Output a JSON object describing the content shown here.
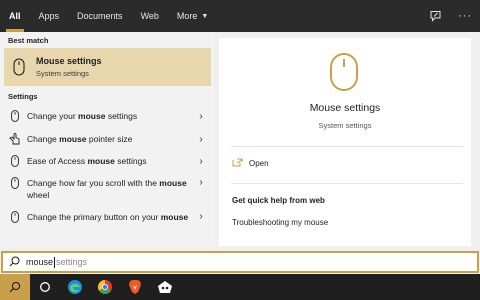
{
  "tabs": [
    {
      "label": "All"
    },
    {
      "label": "Apps"
    },
    {
      "label": "Documents"
    },
    {
      "label": "Web"
    },
    {
      "label": "More"
    }
  ],
  "best_match": {
    "section_label": "Best match",
    "title": "Mouse settings",
    "subtitle": "System settings"
  },
  "settings": {
    "section_label": "Settings",
    "items": [
      {
        "pre": "Change your ",
        "bold": "mouse",
        "post": " settings",
        "icon": "mouse-icon"
      },
      {
        "pre": "Change ",
        "bold": "mouse",
        "post": " pointer size",
        "icon": "pointer-hand-icon"
      },
      {
        "pre": "Ease of Access ",
        "bold": "mouse",
        "post": " settings",
        "icon": "mouse-icon"
      },
      {
        "pre": "Change how far you scroll with the ",
        "bold": "mouse",
        "post": " wheel",
        "icon": "mouse-icon"
      },
      {
        "pre": "Change the primary button on your ",
        "bold": "mouse",
        "post": "",
        "icon": "mouse-icon"
      }
    ]
  },
  "preview": {
    "title": "Mouse settings",
    "subtitle": "System settings",
    "open_label": "Open",
    "help_title": "Get quick help from web",
    "help_link": "Troubleshooting my mouse"
  },
  "search": {
    "typed": "mouse",
    "suggestion": "settings"
  },
  "colors": {
    "accent": "#c9a04a",
    "selected_bg": "#e8d7ad",
    "topbar_bg": "#2b2b2b",
    "taskbar_bg": "#1f1f1f"
  }
}
